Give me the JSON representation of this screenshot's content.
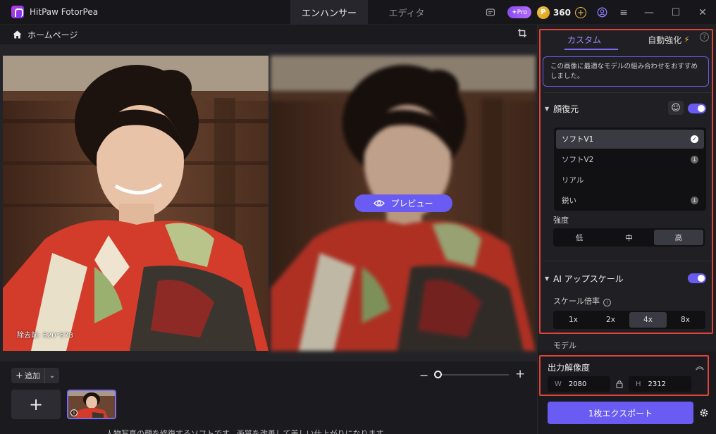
{
  "app": {
    "title": "HitPaw FotorPea"
  },
  "tabs": [
    {
      "label": "エンハンサー"
    },
    {
      "label": "エディタ"
    }
  ],
  "titlebar": {
    "pro_label": "Pro",
    "coin_count": "360"
  },
  "nav": {
    "home_label": "ホームページ"
  },
  "canvas": {
    "before_label": "除去前: 520*578",
    "preview_label": "プレビュー"
  },
  "bottom": {
    "add_label": "追加",
    "under_text": "人物写真の顔を修復するソフトです。画質を改善して美しい仕上がりになります。"
  },
  "panel": {
    "tab_custom": "カスタム",
    "tab_auto": "自動強化",
    "tip": "この画像に最適なモデルの組み合わせをおすすめしました。",
    "face_section": "顔復元",
    "models": [
      {
        "label": "ソフトV1",
        "state": "selected"
      },
      {
        "label": "ソフトV2",
        "state": "download"
      },
      {
        "label": "リアル",
        "state": "none"
      },
      {
        "label": "鋭い",
        "state": "download"
      }
    ],
    "strength_label": "強度",
    "strength_options": [
      "低",
      "中",
      "高"
    ],
    "strength_selected": "高",
    "upscale_section": "AI アップスケール",
    "scale_label": "スケール倍率",
    "scale_options": [
      "1x",
      "2x",
      "4x",
      "8x"
    ],
    "scale_selected": "4x",
    "model_label": "モデル",
    "resolution_title": "出力解像度",
    "width_key": "W",
    "width_value": "2080",
    "height_key": "H",
    "height_value": "2312",
    "export_label": "1枚エクスポート"
  },
  "colors": {
    "accent": "#6a5cf2",
    "highlight": "#e0433c",
    "coin": "#f0c24a"
  }
}
